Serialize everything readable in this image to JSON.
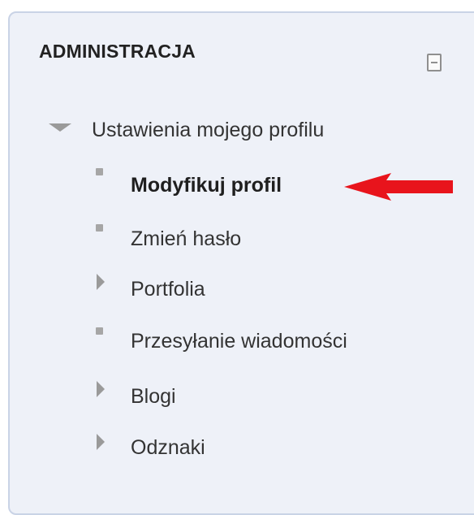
{
  "block": {
    "title": "ADMINISTRACJA",
    "collapse_icon": "collapse-icon"
  },
  "tree": {
    "root": {
      "label": "Ustawienia mojego profilu",
      "icon": "expanded-triangle-icon"
    },
    "items": [
      {
        "label": "Modyfikuj profil",
        "icon": "square-bullet-icon",
        "active": true
      },
      {
        "label": "Zmień hasło",
        "icon": "square-bullet-icon"
      },
      {
        "label": "Portfolia",
        "icon": "collapsed-triangle-icon"
      },
      {
        "label": "Przesyłanie wiadomości",
        "icon": "square-bullet-icon"
      },
      {
        "label": "Blogi",
        "icon": "collapsed-triangle-icon"
      },
      {
        "label": "Odznaki",
        "icon": "collapsed-triangle-icon"
      }
    ]
  },
  "annotation": {
    "icon": "red-arrow-icon",
    "color": "#e8141c"
  },
  "colors": {
    "panel_bg": "#eef1f8",
    "panel_border": "#c9d3e6",
    "text": "#333333",
    "bullet": "#a6a6a6"
  }
}
